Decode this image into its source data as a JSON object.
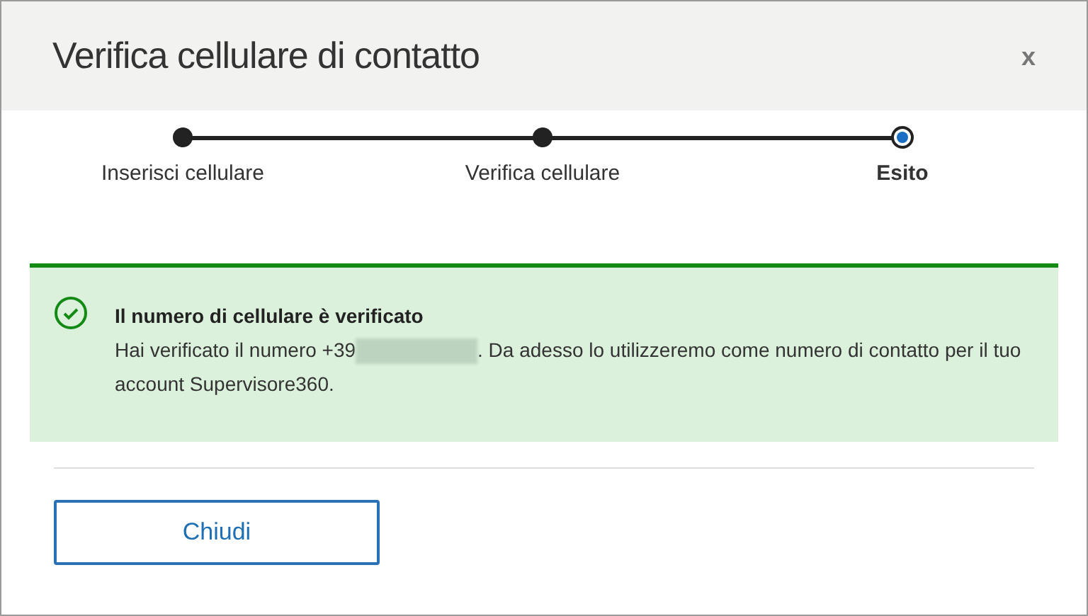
{
  "dialog": {
    "title": "Verifica cellulare di contatto",
    "close": "x"
  },
  "steps": [
    {
      "label": "Inserisci cellulare",
      "current": false
    },
    {
      "label": "Verifica cellulare",
      "current": false
    },
    {
      "label": "Esito",
      "current": true
    }
  ],
  "alert": {
    "title": "Il numero di cellulare è verificato",
    "text_before": "Hai verificato il numero +39",
    "text_after": ". Da adesso lo utilizzeremo come numero di contatto per il tuo account Supervisore360."
  },
  "buttons": [
    "Chiudi"
  ]
}
